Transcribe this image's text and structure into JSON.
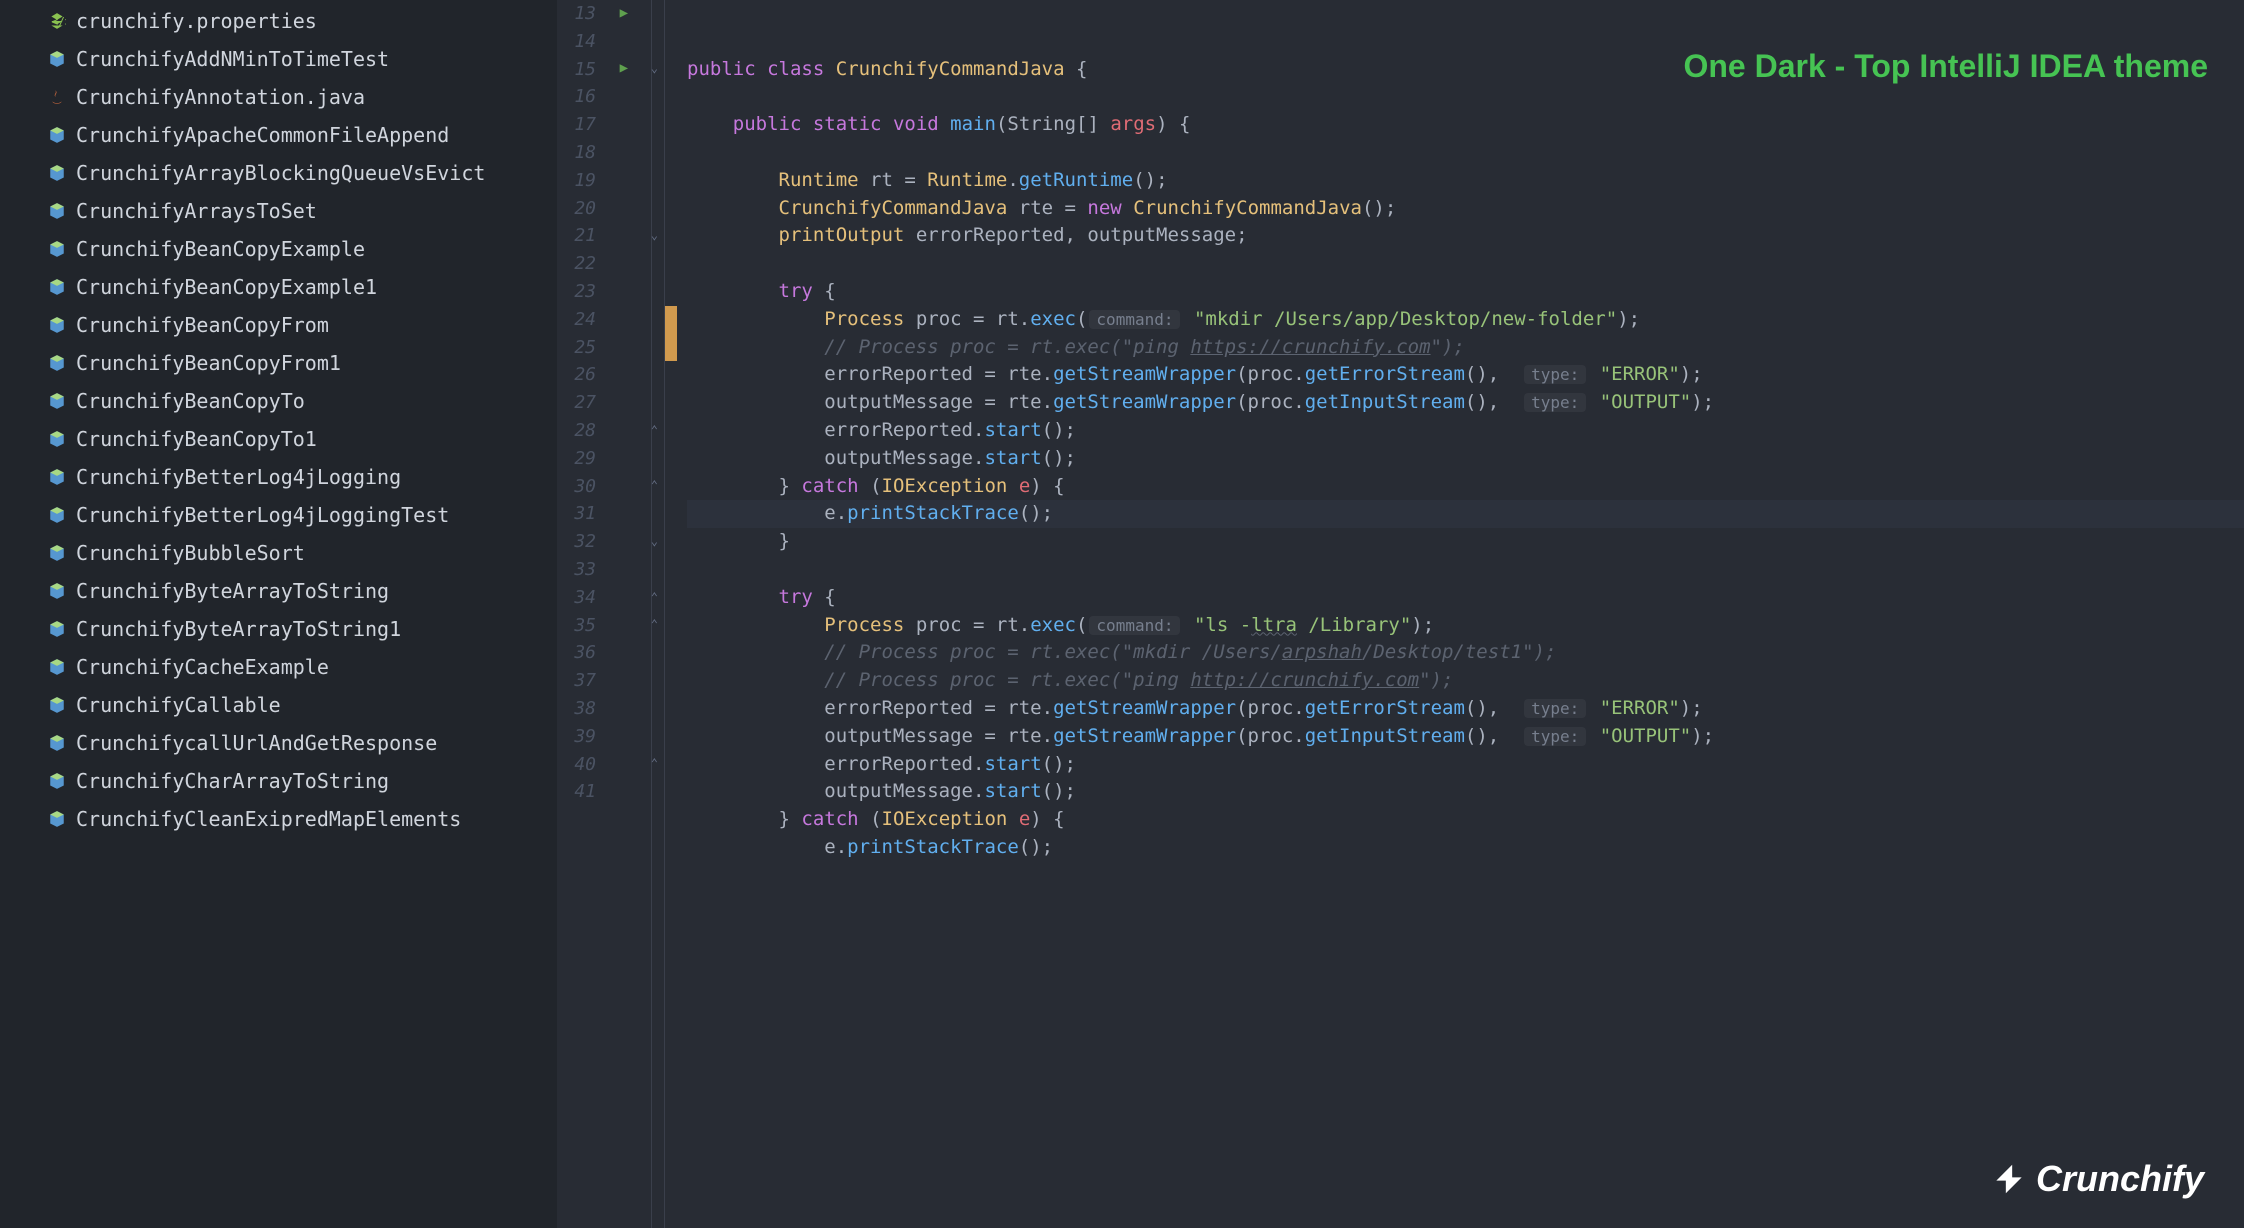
{
  "annotation": "One Dark - Top IntelliJ IDEA theme",
  "brand": "Crunchify",
  "sidebar": {
    "items": [
      {
        "icon": "props",
        "label": "crunchify.properties"
      },
      {
        "icon": "class",
        "label": "CrunchifyAddNMinToTimeTest"
      },
      {
        "icon": "java",
        "label": "CrunchifyAnnotation.java"
      },
      {
        "icon": "class",
        "label": "CrunchifyApacheCommonFileAppend"
      },
      {
        "icon": "class",
        "label": "CrunchifyArrayBlockingQueueVsEvict"
      },
      {
        "icon": "class",
        "label": "CrunchifyArraysToSet"
      },
      {
        "icon": "class",
        "label": "CrunchifyBeanCopyExample"
      },
      {
        "icon": "class",
        "label": "CrunchifyBeanCopyExample1"
      },
      {
        "icon": "class",
        "label": "CrunchifyBeanCopyFrom"
      },
      {
        "icon": "class",
        "label": "CrunchifyBeanCopyFrom1"
      },
      {
        "icon": "class",
        "label": "CrunchifyBeanCopyTo"
      },
      {
        "icon": "class",
        "label": "CrunchifyBeanCopyTo1"
      },
      {
        "icon": "class",
        "label": "CrunchifyBetterLog4jLogging"
      },
      {
        "icon": "class",
        "label": "CrunchifyBetterLog4jLoggingTest"
      },
      {
        "icon": "class",
        "label": "CrunchifyBubbleSort"
      },
      {
        "icon": "class",
        "label": "CrunchifyByteArrayToString"
      },
      {
        "icon": "class",
        "label": "CrunchifyByteArrayToString1"
      },
      {
        "icon": "class",
        "label": "CrunchifyCacheExample"
      },
      {
        "icon": "class",
        "label": "CrunchifyCallable"
      },
      {
        "icon": "class",
        "label": "CrunchifycallUrlAndGetResponse"
      },
      {
        "icon": "class",
        "label": "CrunchifyCharArrayToString"
      },
      {
        "icon": "class",
        "label": "CrunchifyCleanExipredMapElements"
      }
    ]
  },
  "gutter": {
    "start": 13,
    "end": 41,
    "run": [
      13,
      15
    ],
    "foldDown": [
      15,
      21,
      32
    ],
    "foldUp": [
      28,
      30,
      34,
      35,
      40
    ]
  },
  "code": {
    "lines": [
      {
        "n": 13,
        "html": "<span class='kw'>public</span> <span class='kw'>class</span> <span class='cls'>CrunchifyCommandJava</span> <span class='id'>{</span>"
      },
      {
        "n": 14,
        "html": ""
      },
      {
        "n": 15,
        "html": "    <span class='kw'>public</span> <span class='kw'>static</span> <span class='kw'>void</span> <span class='fn'>main</span><span class='id'>(String[]</span> <span class='lit'>args</span><span class='id'>) {</span>"
      },
      {
        "n": 16,
        "html": ""
      },
      {
        "n": 17,
        "html": "        <span class='cls'>Runtime</span> <span class='id'>rt =</span> <span class='cls'>Runtime</span><span class='id'>.</span><span class='fn'>getRuntime</span><span class='id'>();</span>"
      },
      {
        "n": 18,
        "html": "        <span class='cls'>CrunchifyCommandJava</span> <span class='id'>rte =</span> <span class='kw'>new</span> <span class='cls'>CrunchifyCommandJava</span><span class='id'>();</span>"
      },
      {
        "n": 19,
        "html": "        <span class='cls'>printOutput</span> <span class='id'>errorReported, outputMessage;</span>"
      },
      {
        "n": 20,
        "html": ""
      },
      {
        "n": 21,
        "html": "        <span class='kw'>try</span> <span class='id'>{</span>"
      },
      {
        "n": 22,
        "orange": true,
        "html": "            <span class='cls'>Process</span> <span class='id'>proc = rt.</span><span class='fn'>exec</span><span class='id'>(</span><span class='hint'>command:</span> <span class='str'>\"mkdir /Users/app/Desktop/new-folder\"</span><span class='id'>);</span>"
      },
      {
        "n": 23,
        "orange": true,
        "html": "            <span class='cmt'>// Process proc = rt.exec(\"ping <span class='url'>https://crunchify.com</span>\");</span>"
      },
      {
        "n": 24,
        "html": "            <span class='id'>errorReported = rte.</span><span class='fn'>getStreamWrapper</span><span class='id'>(proc.</span><span class='fn'>getErrorStream</span><span class='id'>(),  </span><span class='hint'>type:</span> <span class='str'>\"ERROR\"</span><span class='id'>);</span>"
      },
      {
        "n": 25,
        "html": "            <span class='id'>outputMessage = rte.</span><span class='fn'>getStreamWrapper</span><span class='id'>(proc.</span><span class='fn'>getInputStream</span><span class='id'>(),  </span><span class='hint'>type:</span> <span class='str'>\"OUTPUT\"</span><span class='id'>);</span>"
      },
      {
        "n": 26,
        "html": "            <span class='id'>errorReported.</span><span class='fn'>start</span><span class='id'>();</span>"
      },
      {
        "n": 27,
        "html": "            <span class='id'>outputMessage.</span><span class='fn'>start</span><span class='id'>();</span>"
      },
      {
        "n": 28,
        "html": "        <span class='id'>}</span> <span class='kw'>catch</span> <span class='id'>(</span><span class='cls'>IOException</span> <span class='lit'>e</span><span class='id'>) {</span>"
      },
      {
        "n": 29,
        "hl": true,
        "html": "            <span class='id'>e.</span><span class='fn'>printStackTrace</span><span class='id'>();</span>"
      },
      {
        "n": 30,
        "html": "        <span class='id'>}</span>"
      },
      {
        "n": 31,
        "html": ""
      },
      {
        "n": 32,
        "html": "        <span class='kw'>try</span> <span class='id'>{</span>"
      },
      {
        "n": 33,
        "html": "            <span class='cls'>Process</span> <span class='id'>proc = rt.</span><span class='fn'>exec</span><span class='id'>(</span><span class='hint'>command:</span> <span class='str'>\"ls -<span class='wavy'>ltra</span> /Library\"</span><span class='id'>);</span>"
      },
      {
        "n": 34,
        "html": "            <span class='cmt'>// Process proc = rt.exec(\"mkdir /Users/<span class='url'>arpshah</span>/Desktop/test1\");</span>"
      },
      {
        "n": 35,
        "html": "            <span class='cmt'>// Process proc = rt.exec(\"ping <span class='url'>http://crunchify.com</span>\");</span>"
      },
      {
        "n": 36,
        "html": "            <span class='id'>errorReported = rte.</span><span class='fn'>getStreamWrapper</span><span class='id'>(proc.</span><span class='fn'>getErrorStream</span><span class='id'>(),  </span><span class='hint'>type:</span> <span class='str'>\"ERROR\"</span><span class='id'>);</span>"
      },
      {
        "n": 37,
        "html": "            <span class='id'>outputMessage = rte.</span><span class='fn'>getStreamWrapper</span><span class='id'>(proc.</span><span class='fn'>getInputStream</span><span class='id'>(),  </span><span class='hint'>type:</span> <span class='str'>\"OUTPUT\"</span><span class='id'>);</span>"
      },
      {
        "n": 38,
        "html": "            <span class='id'>errorReported.</span><span class='fn'>start</span><span class='id'>();</span>"
      },
      {
        "n": 39,
        "html": "            <span class='id'>outputMessage.</span><span class='fn'>start</span><span class='id'>();</span>"
      },
      {
        "n": 40,
        "html": "        <span class='id'>}</span> <span class='kw'>catch</span> <span class='id'>(</span><span class='cls'>IOException</span> <span class='lit'>e</span><span class='id'>) {</span>"
      },
      {
        "n": 41,
        "html": "            <span class='id'>e.</span><span class='fn'>printStackTrace</span><span class='id'>();</span>"
      }
    ]
  }
}
